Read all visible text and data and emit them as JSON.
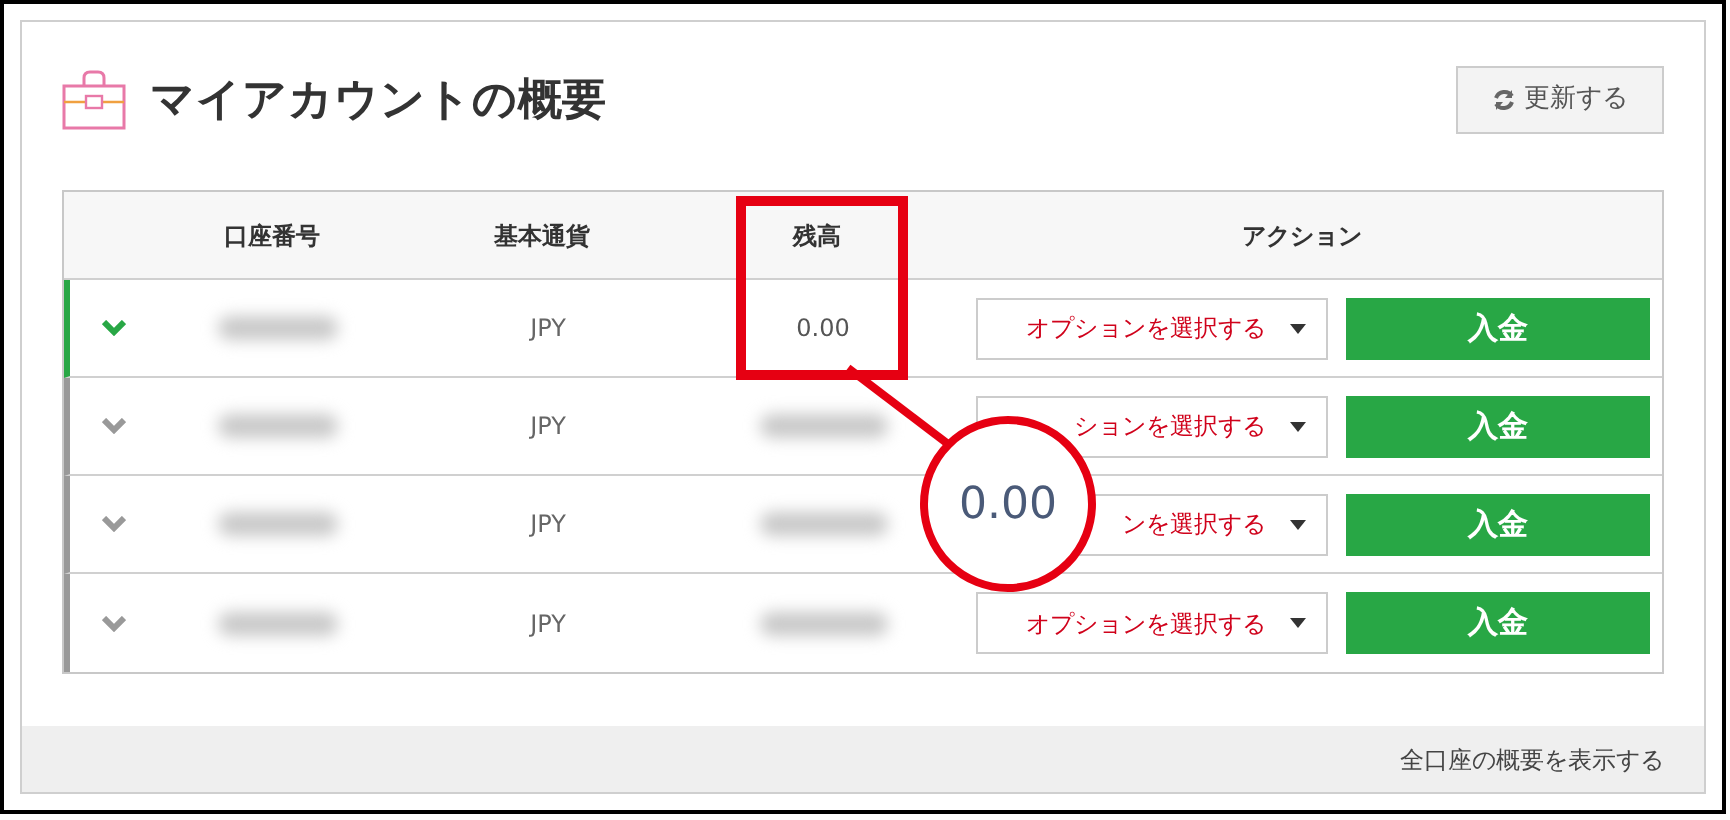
{
  "panel": {
    "title": "マイアカウントの概要",
    "refresh_button": "更新する"
  },
  "table": {
    "columns": [
      "口座番号",
      "基本通貨",
      "残高",
      "アクション"
    ],
    "rows": [
      {
        "selected": true,
        "account": {
          "blurred": true
        },
        "currency": "JPY",
        "balance": {
          "text": "0.00"
        },
        "option_select": "オプションを選択する",
        "deposit_button": "入金"
      },
      {
        "selected": false,
        "account": {
          "blurred": true
        },
        "currency": "JPY",
        "balance": {
          "blurred": true
        },
        "option_select": "ションを選択する",
        "deposit_button": "入金"
      },
      {
        "selected": false,
        "account": {
          "blurred": true
        },
        "currency": "JPY",
        "balance": {
          "blurred": true
        },
        "option_select": "ンを選択する",
        "deposit_button": "入金"
      },
      {
        "selected": false,
        "account": {
          "blurred": true
        },
        "currency": "JPY",
        "balance": {
          "blurred": true
        },
        "option_select": "オプションを選択する",
        "deposit_button": "入金"
      }
    ]
  },
  "callout": {
    "text": "0.00"
  },
  "footer": {
    "link": "全口座の概要を表示する"
  }
}
